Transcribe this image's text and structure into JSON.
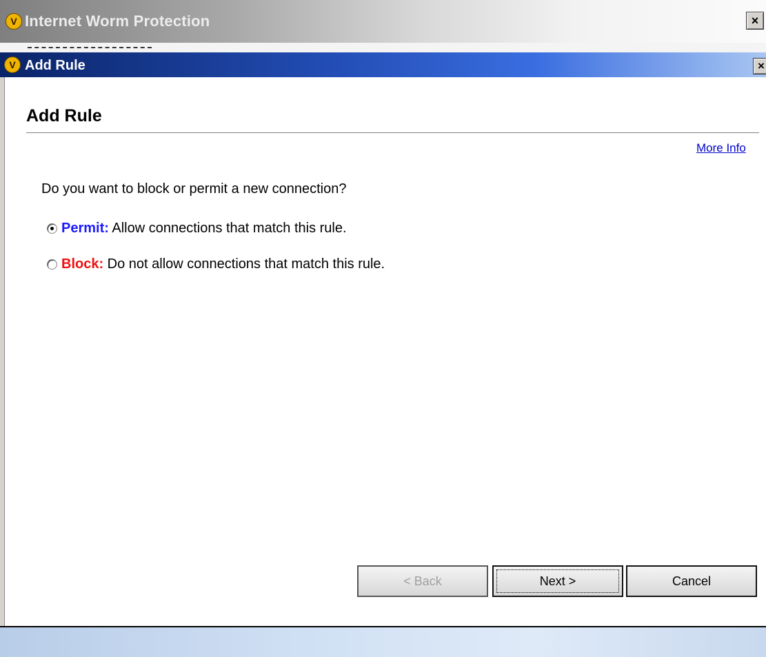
{
  "parent_window": {
    "title": "Internet Worm Protection",
    "close_symbol": "×",
    "icon": "norton-shield-icon"
  },
  "dialog": {
    "title": "Add Rule",
    "close_symbol": "×",
    "icon": "norton-shield-icon"
  },
  "content": {
    "heading": "Add Rule",
    "more_info": "More Info",
    "question": "Do you want to block or permit a new connection?",
    "options": [
      {
        "keyword": "Permit:",
        "description": " Allow connections that match this rule.",
        "selected": true,
        "color": "#1a1aff"
      },
      {
        "keyword": "Block:",
        "description": " Do not allow connections that match this rule.",
        "selected": false,
        "color": "#ee1111"
      }
    ]
  },
  "buttons": {
    "back": "< Back",
    "next": "Next >",
    "cancel": "Cancel"
  }
}
